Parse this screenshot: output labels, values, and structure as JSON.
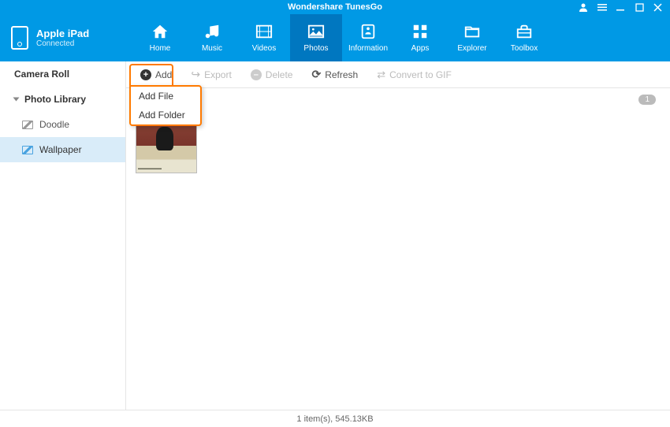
{
  "app": {
    "title": "Wondershare TunesGo"
  },
  "device": {
    "name": "Apple iPad",
    "status": "Connected"
  },
  "nav": {
    "items": [
      {
        "label": "Home"
      },
      {
        "label": "Music"
      },
      {
        "label": "Videos"
      },
      {
        "label": "Photos"
      },
      {
        "label": "Information"
      },
      {
        "label": "Apps"
      },
      {
        "label": "Explorer"
      },
      {
        "label": "Toolbox"
      }
    ],
    "active_index": 3
  },
  "sidebar": {
    "items": [
      {
        "label": "Camera Roll"
      },
      {
        "label": "Photo Library"
      },
      {
        "label": "Doodle"
      },
      {
        "label": "Wallpaper"
      }
    ],
    "selected_index": 3
  },
  "toolbar": {
    "add": "Add",
    "export": "Export",
    "delete": "Delete",
    "refresh": "Refresh",
    "convert": "Convert to GIF",
    "dropdown": {
      "add_file": "Add File",
      "add_folder": "Add Folder"
    }
  },
  "content": {
    "badge": "1"
  },
  "status": {
    "text": "1 item(s), 545.13KB"
  }
}
